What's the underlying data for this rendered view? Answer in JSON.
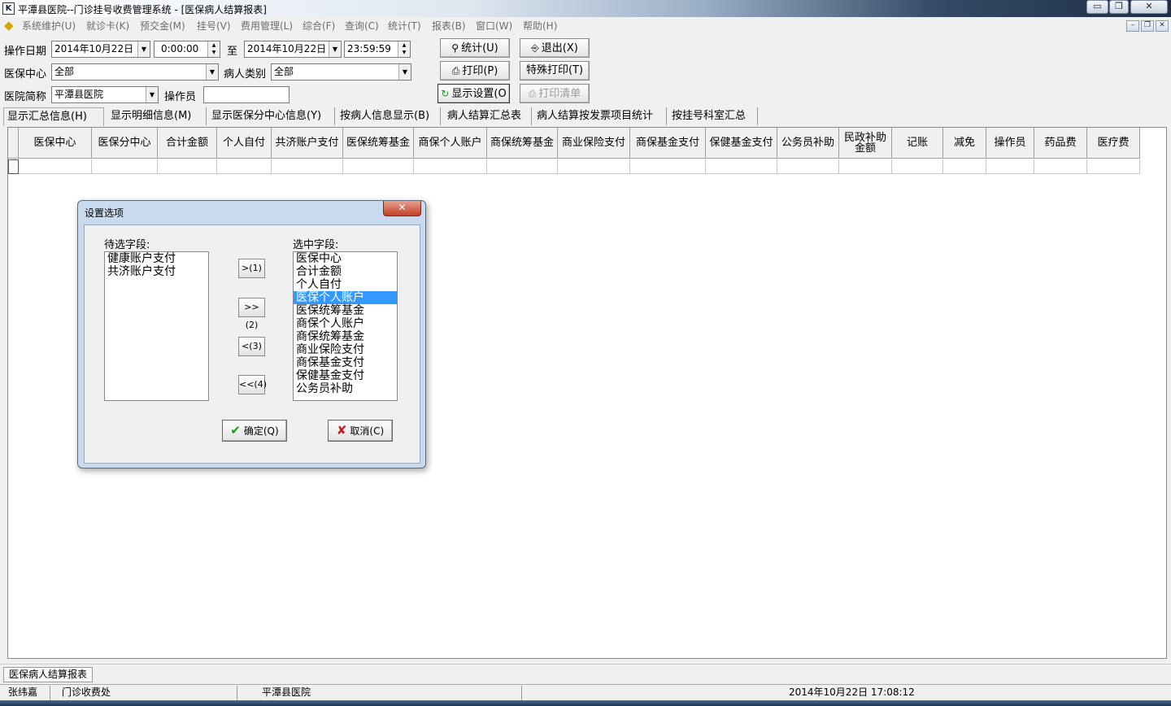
{
  "window": {
    "title": "平潭县医院--门诊挂号收费管理系统 - [医保病人结算报表]",
    "app_icon": "app-logo-icon",
    "controls": {
      "minimize": "▭",
      "restore": "❐",
      "close": "✕"
    }
  },
  "menubar": {
    "items": [
      "系统维护(U)",
      "就诊卡(K)",
      "预交金(M)",
      "挂号(V)",
      "费用管理(L)",
      "综合(F)",
      "查询(C)",
      "统计(T)",
      "报表(B)",
      "窗口(W)",
      "帮助(H)"
    ],
    "mdi_controls": {
      "minimize": "–",
      "restore": "❐",
      "close": "✕"
    }
  },
  "filters": {
    "op_date_label": "操作日期",
    "start_date": "2014年10月22日",
    "start_time": "0:00:00",
    "to_label": "至",
    "end_date": "2014年10月22日",
    "end_time": "23:59:59",
    "center_label": "医保中心",
    "center_value": "全部",
    "patient_type_label": "病人类别",
    "patient_type_value": "全部",
    "hospital_label": "医院简称",
    "hospital_value": "平潭县医院",
    "operator_label": "操作员",
    "operator_value": ""
  },
  "buttons": {
    "stat": "统计(U)",
    "exit": "退出(X)",
    "print": "打印(P)",
    "special_print": "特殊打印(T)",
    "display_settings": "显示设置(O",
    "print_list": "打印清单"
  },
  "tabs": [
    "显示汇总信息(H)",
    "显示明细信息(M)",
    "显示医保分中心信息(Y)",
    "按病人信息显示(B)",
    "病人结算汇总表",
    "病人结算按发票项目统计",
    "按挂号科室汇总"
  ],
  "grid": {
    "columns": [
      "医保中心",
      "医保分中心",
      "合计金额",
      "个人自付",
      "共济账户支付",
      "医保统筹基金",
      "商保个人账户",
      "商保统筹基金",
      "商业保险支付",
      "商保基金支付",
      "保健基金支付",
      "公务员补助",
      "民政补助金额",
      "记账",
      "减免",
      "操作员",
      "药品费",
      "医疗费"
    ]
  },
  "dialog": {
    "title": "设置选项",
    "close_glyph": "✕",
    "available_label": "待选字段:",
    "available_fields": [
      "健康账户支付",
      "共济账户支付"
    ],
    "selected_label": "选中字段:",
    "selected_fields": [
      "医保中心",
      "合计金额",
      "个人自付",
      "医保个人账户",
      "医保统筹基金",
      "商保个人账户",
      "商保统筹基金",
      "商业保险支付",
      "商保基金支付",
      "保健基金支付",
      "公务员补助"
    ],
    "selected_highlight": "医保个人账户",
    "move_buttons": [
      ">(1)",
      ">>(2)",
      "<(3)",
      "<<(4)"
    ],
    "ok_label": "确定(Q)",
    "cancel_label": "取消(C)"
  },
  "mdi_tab": "医保病人结算报表",
  "statusbar": {
    "user": "张纬嘉",
    "department": "门诊收费处",
    "hospital": "平潭县医院",
    "datetime": "2014年10月22日 17:08:12"
  }
}
